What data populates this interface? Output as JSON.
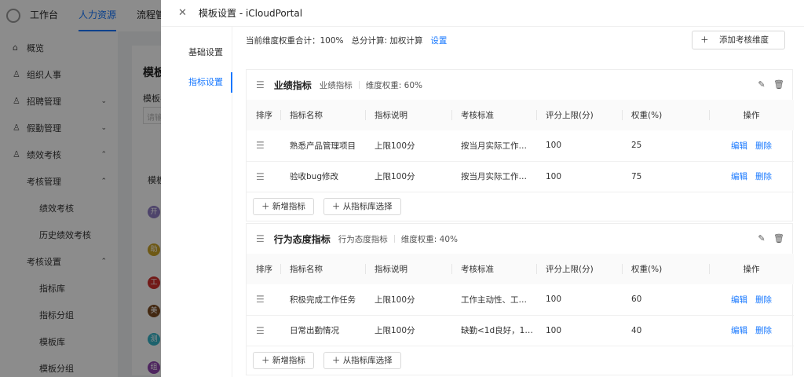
{
  "topbar": {
    "items": [
      "工作台",
      "人力资源",
      "流程管"
    ]
  },
  "sidebar": {
    "items": [
      {
        "label": "概览",
        "icon": "home-icon"
      },
      {
        "label": "组织人事",
        "icon": "user-icon"
      },
      {
        "label": "招聘管理",
        "icon": "user-icon",
        "chev": "⌄"
      },
      {
        "label": "假勤管理",
        "icon": "user-icon",
        "chev": "⌄"
      },
      {
        "label": "绩效考核",
        "icon": "user-icon",
        "chev": "⌃"
      },
      {
        "label": "考核管理",
        "chev": "⌃"
      },
      {
        "label": "绩效考核"
      },
      {
        "label": "历史绩效考核"
      },
      {
        "label": "考核设置",
        "chev": "⌃"
      },
      {
        "label": "指标库"
      },
      {
        "label": "指标分组"
      },
      {
        "label": "模板库"
      },
      {
        "label": "模板分组"
      }
    ]
  },
  "background": {
    "title": "模板",
    "label": "模板名",
    "input_placeholder": "请输",
    "column": "模板",
    "avatars": [
      "开",
      "助",
      "工",
      "美",
      "测",
      "组"
    ]
  },
  "drawer": {
    "title": "模板设置 - iCloudPortal",
    "tabs": [
      "基础设置",
      "指标设置"
    ],
    "summary": {
      "weight_total": "当前维度权重合计：100%",
      "score_calc": "总分计算: 加权计算",
      "settings_link": "设置"
    },
    "add_dimension": "添加考核维度",
    "columns": [
      "排序",
      "指标名称",
      "指标说明",
      "考核标准",
      "评分上限(分)",
      "权重(%)",
      "操作"
    ],
    "groups": [
      {
        "name": "业绩指标",
        "subtitle": "业绩指标",
        "weight": "维度权重: 60%",
        "rows": [
          {
            "name": "熟悉产品管理项目",
            "desc": "上限100分",
            "standard": "按当月实际工作…",
            "max": "100",
            "weight": "25"
          },
          {
            "name": "验收bug修改",
            "desc": "上限100分",
            "standard": "按当月实际工作…",
            "max": "100",
            "weight": "75"
          }
        ]
      },
      {
        "name": "行为态度指标",
        "subtitle": "行为态度指标",
        "weight": "维度权重: 40%",
        "rows": [
          {
            "name": "积极完成工作任务",
            "desc": "上限100分",
            "standard": "工作主动性、工…",
            "max": "100",
            "weight": "60"
          },
          {
            "name": "日常出勤情况",
            "desc": "上限100分",
            "standard": "缺勤<1d良好，1…",
            "max": "100",
            "weight": "40"
          }
        ]
      }
    ],
    "row_actions": {
      "edit": "编辑",
      "delete": "删除"
    },
    "footer": {
      "add_indicator": "新增指标",
      "select_from_library": "从指标库选择"
    }
  }
}
